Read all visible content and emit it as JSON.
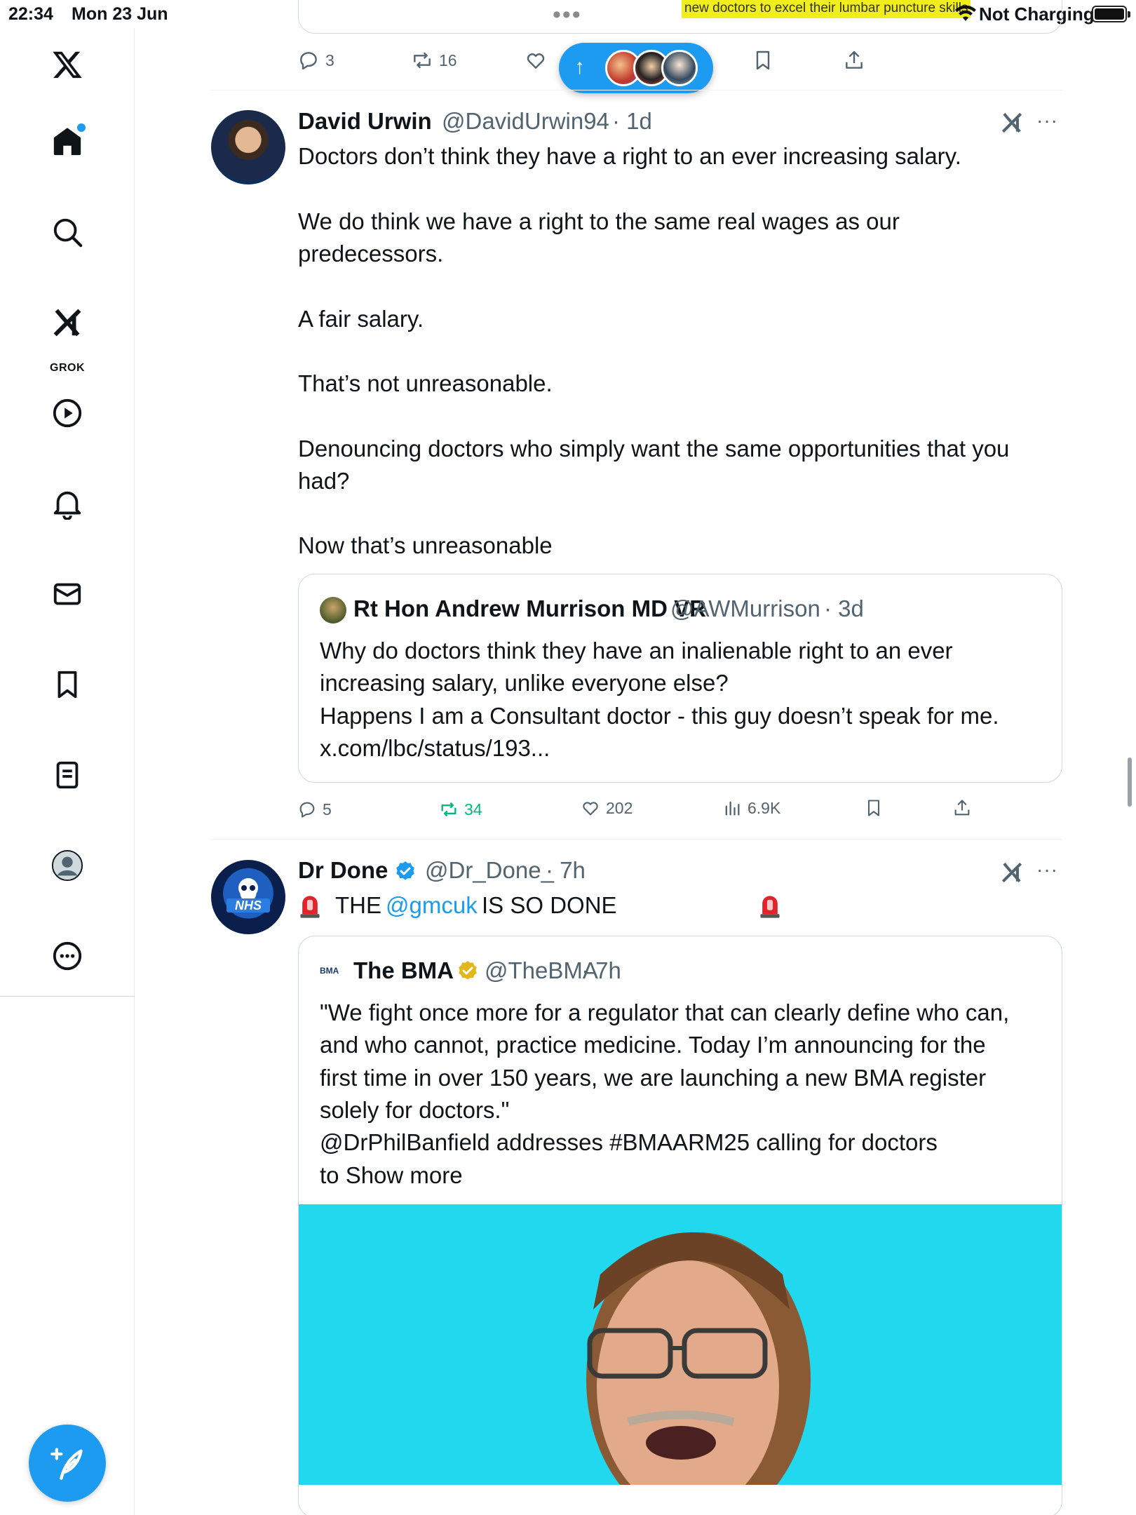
{
  "status_bar": {
    "time": "22:34",
    "date": "Mon 23 Jun",
    "ticker_text": "new doctors to excel their lumbar puncture skills",
    "charging": "Not Charging"
  },
  "nav": {
    "items": [
      "home",
      "explore",
      "grok",
      "video",
      "notifications",
      "messages",
      "bookmarks",
      "lists",
      "profile",
      "more"
    ],
    "grok_label": "GROK"
  },
  "top_tweet": {
    "replies": "3",
    "reposts": "16"
  },
  "tweets": [
    {
      "name": "David Urwin",
      "handle": "@DavidUrwin94",
      "time": "· 1d",
      "lines": [
        "Doctors don’t think they have a right to an ever increasing salary.",
        "We do think we have a right to the same real wages as our",
        "predecessors.",
        "A fair salary.",
        "That’s not unreasonable.",
        "Denouncing doctors who simply want the same opportunities that you",
        "had?",
        "Now that’s unreasonable"
      ],
      "quote": {
        "name": "Rt Hon Andrew Murrison MD VR",
        "handle": "@AWMurrison",
        "time": "· 3d",
        "lines": [
          "Why do doctors think they have an inalienable right to an ever",
          "increasing salary, unlike everyone else?",
          "Happens I am a Consultant doctor - this guy doesn’t speak for me.",
          "x.com/lbc/status/193..."
        ]
      },
      "stats": {
        "replies": "5",
        "reposts": "34",
        "likes": "202",
        "views": "6.9K"
      }
    },
    {
      "name": "Dr Done",
      "handle": "@Dr_Done_",
      "time": "· 7h",
      "text_before": "THE",
      "mention": "@gmcuk",
      "text_after": "IS SO DONE",
      "quote": {
        "name": "The BMA",
        "handle": "@TheBMA",
        "time": "· 7h",
        "logo_text": "BMA",
        "lines": [
          "\"We fight once more for a regulator that can clearly define who can,",
          "and who cannot, practice medicine. Today I’m announcing for the",
          "first time in over 150 years, we are launching a new BMA register",
          "solely for doctors.\"",
          "@DrPhilBanfield addresses #BMAARM25 calling for doctors",
          "to Show more"
        ]
      }
    }
  ],
  "colors": {
    "accent": "#1d9bf0",
    "repost_active": "#00ba7c",
    "muted": "#536471",
    "ticker_bg": "#f1ee1d",
    "media_bg": "#22d8ef"
  }
}
